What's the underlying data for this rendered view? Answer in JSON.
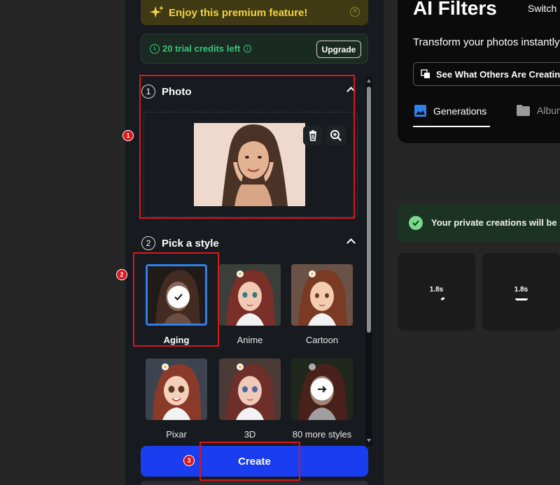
{
  "premium": {
    "text": "Enjoy this premium feature!"
  },
  "credits": {
    "text": "20 trial credits left",
    "upgrade_label": "Upgrade"
  },
  "photo_section": {
    "number": "1",
    "title": "Photo"
  },
  "style_section": {
    "number": "2",
    "title": "Pick a style",
    "styles": [
      {
        "label": "Aging",
        "selected": true
      },
      {
        "label": "Anime",
        "selected": false
      },
      {
        "label": "Cartoon",
        "selected": false
      },
      {
        "label": "Pixar",
        "selected": false
      },
      {
        "label": "3D",
        "selected": false
      },
      {
        "label": "80 more styles",
        "selected": false
      }
    ]
  },
  "create_label": "Create",
  "annotations": {
    "badge1": "1",
    "badge2": "2",
    "badge3": "3"
  },
  "right": {
    "title": "AI Filters",
    "switch_label": "Switch",
    "description": "Transform your photos instantly",
    "others_button": "See What Others Are Creating",
    "tabs": [
      {
        "label": "Generations",
        "active": true
      },
      {
        "label": "Albums",
        "active": false
      }
    ],
    "notice": "Your private creations will be saved",
    "tiles": [
      {
        "time": "1.8s"
      },
      {
        "time": "1.8s"
      }
    ]
  },
  "colors": {
    "accent_blue": "#1a3df0",
    "selection_blue": "#2f80ed",
    "credits_green": "#3bc47a",
    "premium_yellow": "#f5d43c",
    "annotation_red": "#d9161c"
  }
}
